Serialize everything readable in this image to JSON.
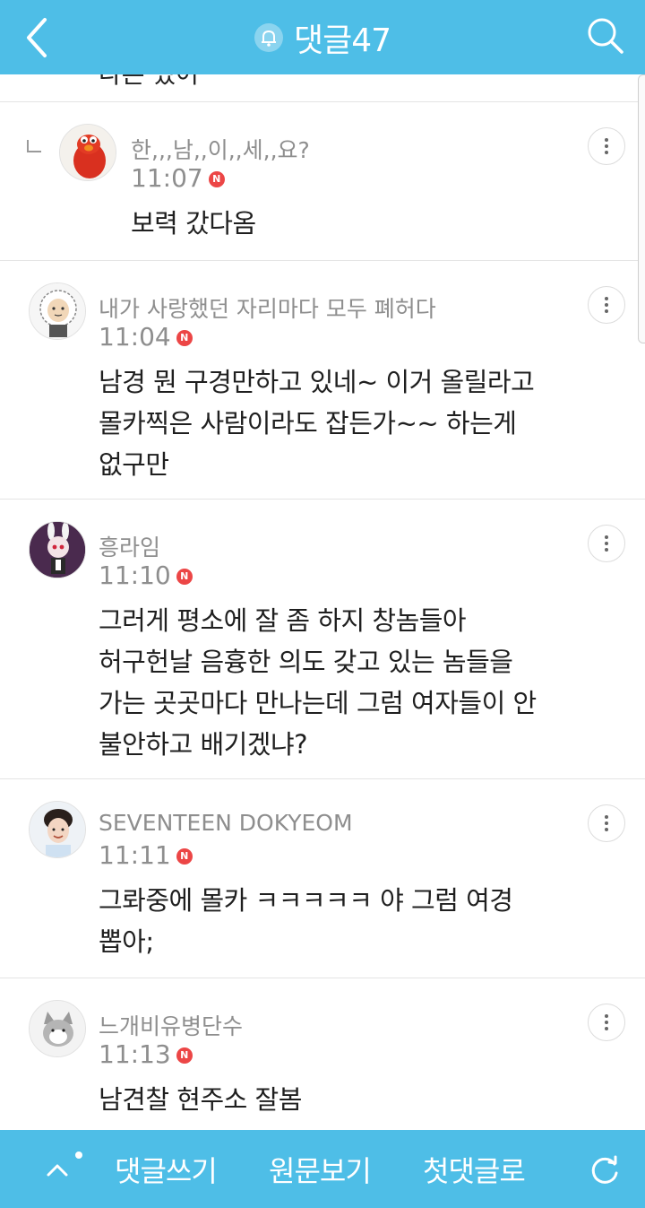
{
  "header": {
    "back_icon": "chevron-left-icon",
    "bell_icon": "bell-icon",
    "title": "댓글47",
    "search_icon": "search-icon",
    "background": "#4ebee7"
  },
  "previous_comment_tail": "다른 였어",
  "comments": [
    {
      "is_reply": true,
      "author": "한,,,남,,이,,세,,요?",
      "time": "11:07",
      "new_badge": "N",
      "body_lines": [
        "보력 갔다옴"
      ]
    },
    {
      "is_reply": false,
      "author": "내가 사랑했던 자리마다 모두 폐허다",
      "time": "11:04",
      "new_badge": "N",
      "body_lines": [
        "남경 뭔 구경만하고 있네~ 이거 올릴라고",
        "몰카찍은 사람이라도 잡든가~~ 하는게",
        "없구만"
      ]
    },
    {
      "is_reply": false,
      "author": "흥라임",
      "time": "11:10",
      "new_badge": "N",
      "body_lines": [
        "그러게 평소에 잘 좀 하지 창놈들아",
        "허구헌날 음흉한 의도 갖고 있는 놈들을",
        "가는 곳곳마다 만나는데 그럼 여자들이 안",
        "불안하고 배기겠냐?"
      ]
    },
    {
      "is_reply": false,
      "author": "SEVENTEEN DOKYEOM",
      "time": "11:11",
      "new_badge": "N",
      "body_lines": [
        "그롸중에 몰카 ㅋㅋㅋㅋㅋ 야 그럼 여경",
        "뽑아;"
      ]
    },
    {
      "is_reply": false,
      "author": "느개비유병단수",
      "time": "11:13",
      "new_badge": "N",
      "body_lines": [
        "남견찰 현주소 잘봄"
      ]
    }
  ],
  "footer": {
    "up_icon": "chevron-up-icon",
    "write_label": "댓글쓰기",
    "original_label": "원문보기",
    "first_label": "첫댓글로",
    "refresh_icon": "refresh-icon"
  },
  "colors": {
    "accent": "#4ebee7",
    "new_badge": "#ec4646",
    "meta_text": "#8e8e8e"
  }
}
